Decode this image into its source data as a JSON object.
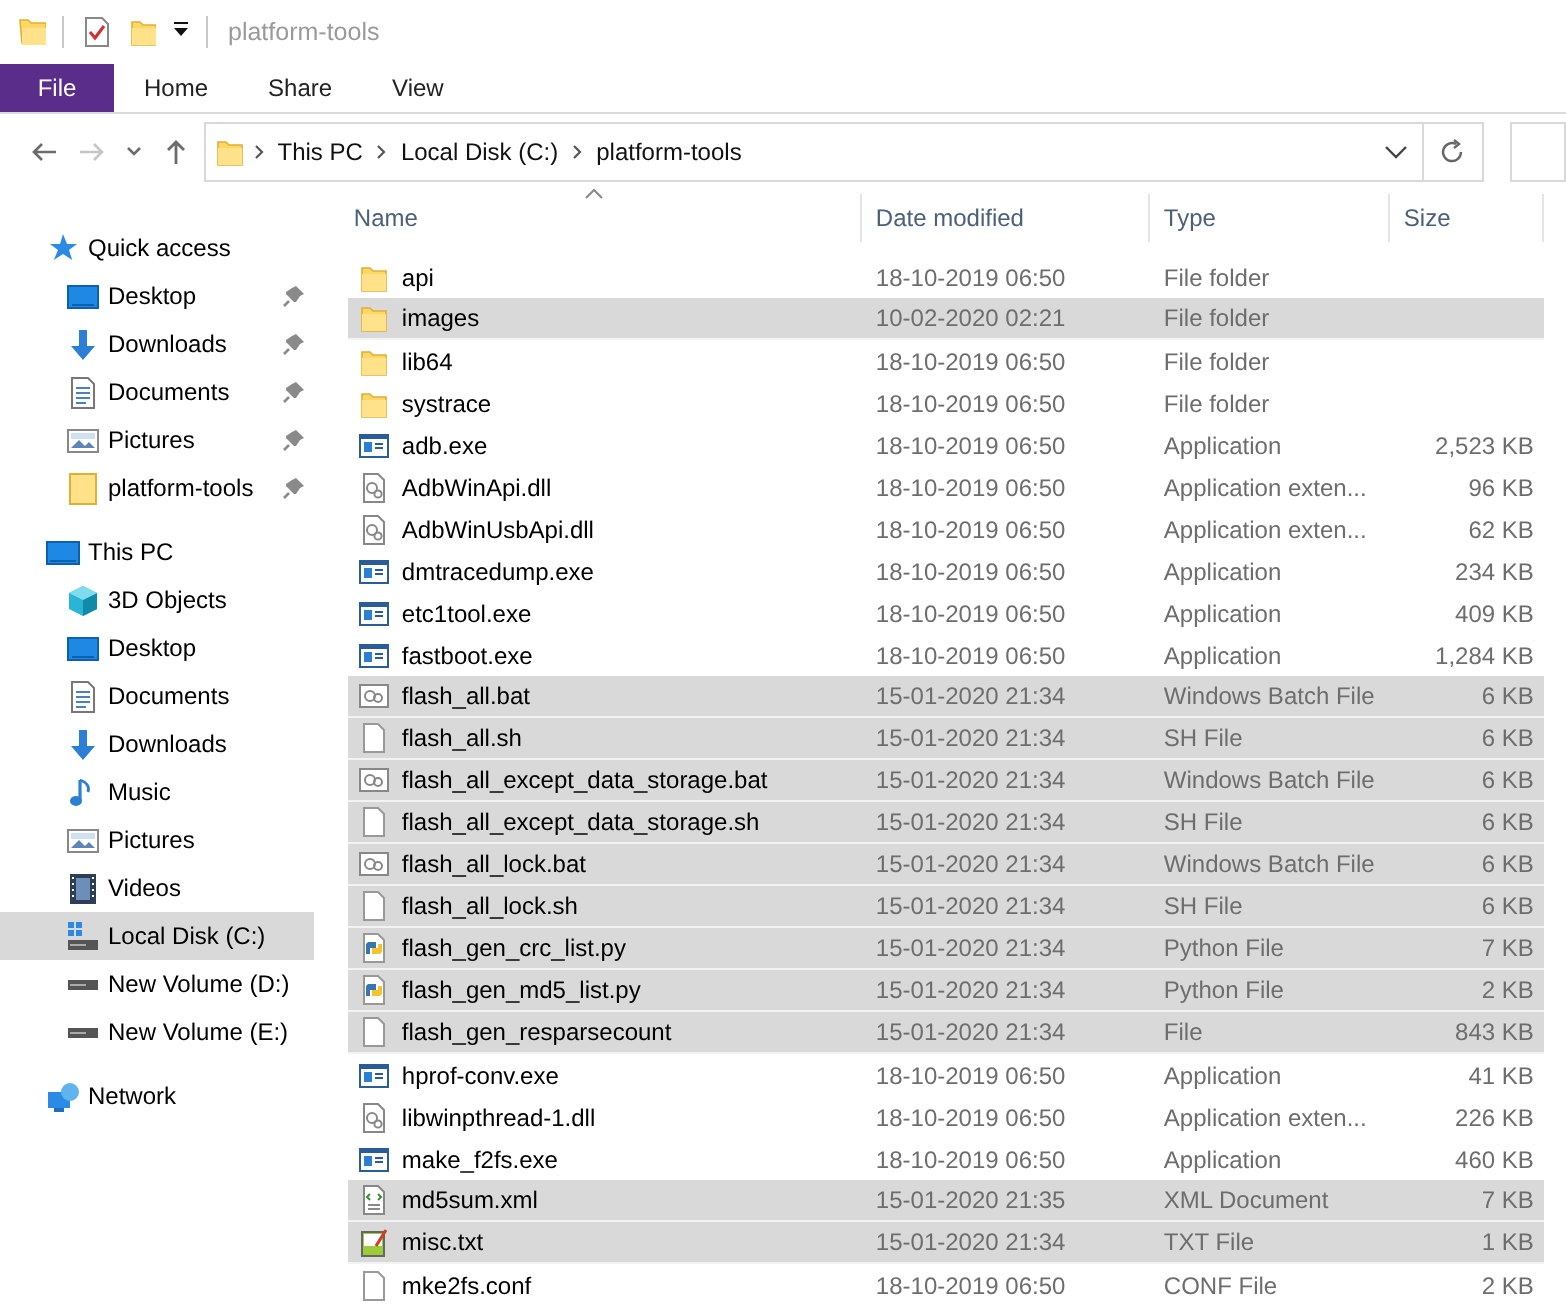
{
  "window": {
    "title": "platform-tools"
  },
  "ribbon_tabs": [
    {
      "label": "File",
      "kind": "menu"
    },
    {
      "label": "Home",
      "kind": "tab"
    },
    {
      "label": "Share",
      "kind": "tab"
    },
    {
      "label": "View",
      "kind": "tab"
    }
  ],
  "nav_buttons": [
    {
      "kind": "back",
      "disabled": false
    },
    {
      "kind": "forward",
      "disabled": true
    },
    {
      "kind": "recent",
      "disabled": false
    },
    {
      "kind": "up",
      "disabled": false
    }
  ],
  "address_bar": {
    "path": [
      "This PC",
      "Local Disk (C:)",
      "platform-tools"
    ]
  },
  "sidebar": {
    "items": [
      {
        "label": "Quick access",
        "kind": "star",
        "selected": false,
        "children": [
          {
            "label": "Desktop",
            "kind": "desktop",
            "pinned": true,
            "selected": false
          },
          {
            "label": "Downloads",
            "kind": "download",
            "pinned": true,
            "selected": false
          },
          {
            "label": "Documents",
            "kind": "document",
            "pinned": true,
            "selected": false
          },
          {
            "label": "Pictures",
            "kind": "pictures",
            "pinned": true,
            "selected": false
          },
          {
            "label": "platform-tools",
            "kind": "folder",
            "pinned": true,
            "selected": false
          }
        ]
      },
      {
        "label": "This PC",
        "kind": "pc",
        "selected": false,
        "children": [
          {
            "label": "3D Objects",
            "kind": "cube",
            "pinned": false,
            "selected": false
          },
          {
            "label": "Desktop",
            "kind": "desktop",
            "pinned": false,
            "selected": false
          },
          {
            "label": "Documents",
            "kind": "document",
            "pinned": false,
            "selected": false
          },
          {
            "label": "Downloads",
            "kind": "download",
            "pinned": false,
            "selected": false
          },
          {
            "label": "Music",
            "kind": "music",
            "pinned": false,
            "selected": false
          },
          {
            "label": "Pictures",
            "kind": "pictures",
            "pinned": false,
            "selected": false
          },
          {
            "label": "Videos",
            "kind": "videos",
            "pinned": false,
            "selected": false
          },
          {
            "label": "Local Disk (C:)",
            "kind": "system-drive",
            "pinned": false,
            "selected": true
          },
          {
            "label": "New Volume (D:)",
            "kind": "drive",
            "pinned": false,
            "selected": false
          },
          {
            "label": "New Volume (E:)",
            "kind": "drive",
            "pinned": false,
            "selected": false
          }
        ]
      },
      {
        "label": "Network",
        "kind": "network",
        "selected": false
      }
    ]
  },
  "file_list": {
    "columns": [
      {
        "label": "Name",
        "sorted": true
      },
      {
        "label": "Date modified",
        "sorted": false
      },
      {
        "label": "Type",
        "sorted": false
      },
      {
        "label": "Size",
        "sorted": false
      }
    ],
    "rows": [
      {
        "name": "api",
        "date": "18-10-2019 06:50",
        "type": "File folder",
        "size": "",
        "kind": "folder",
        "selected": false
      },
      {
        "name": "images",
        "date": "10-02-2020 02:21",
        "type": "File folder",
        "size": "",
        "kind": "folder",
        "selected": true
      },
      {
        "name": "lib64",
        "date": "18-10-2019 06:50",
        "type": "File folder",
        "size": "",
        "kind": "folder",
        "selected": false
      },
      {
        "name": "systrace",
        "date": "18-10-2019 06:50",
        "type": "File folder",
        "size": "",
        "kind": "folder",
        "selected": false
      },
      {
        "name": "adb.exe",
        "date": "18-10-2019 06:50",
        "type": "Application",
        "size": "2,523 KB",
        "kind": "exe",
        "selected": false
      },
      {
        "name": "AdbWinApi.dll",
        "date": "18-10-2019 06:50",
        "type": "Application exten...",
        "size": "96 KB",
        "kind": "dll",
        "selected": false
      },
      {
        "name": "AdbWinUsbApi.dll",
        "date": "18-10-2019 06:50",
        "type": "Application exten...",
        "size": "62 KB",
        "kind": "dll",
        "selected": false
      },
      {
        "name": "dmtracedump.exe",
        "date": "18-10-2019 06:50",
        "type": "Application",
        "size": "234 KB",
        "kind": "exe",
        "selected": false
      },
      {
        "name": "etc1tool.exe",
        "date": "18-10-2019 06:50",
        "type": "Application",
        "size": "409 KB",
        "kind": "exe",
        "selected": false
      },
      {
        "name": "fastboot.exe",
        "date": "18-10-2019 06:50",
        "type": "Application",
        "size": "1,284 KB",
        "kind": "exe",
        "selected": false
      },
      {
        "name": "flash_all.bat",
        "date": "15-01-2020 21:34",
        "type": "Windows Batch File",
        "size": "6 KB",
        "kind": "bat",
        "selected": true
      },
      {
        "name": "flash_all.sh",
        "date": "15-01-2020 21:34",
        "type": "SH File",
        "size": "6 KB",
        "kind": "file",
        "selected": true
      },
      {
        "name": "flash_all_except_data_storage.bat",
        "date": "15-01-2020 21:34",
        "type": "Windows Batch File",
        "size": "6 KB",
        "kind": "bat",
        "selected": true
      },
      {
        "name": "flash_all_except_data_storage.sh",
        "date": "15-01-2020 21:34",
        "type": "SH File",
        "size": "6 KB",
        "kind": "file",
        "selected": true
      },
      {
        "name": "flash_all_lock.bat",
        "date": "15-01-2020 21:34",
        "type": "Windows Batch File",
        "size": "6 KB",
        "kind": "bat",
        "selected": true
      },
      {
        "name": "flash_all_lock.sh",
        "date": "15-01-2020 21:34",
        "type": "SH File",
        "size": "6 KB",
        "kind": "file",
        "selected": true
      },
      {
        "name": "flash_gen_crc_list.py",
        "date": "15-01-2020 21:34",
        "type": "Python File",
        "size": "7 KB",
        "kind": "py",
        "selected": true
      },
      {
        "name": "flash_gen_md5_list.py",
        "date": "15-01-2020 21:34",
        "type": "Python File",
        "size": "2 KB",
        "kind": "py",
        "selected": true
      },
      {
        "name": "flash_gen_resparsecount",
        "date": "15-01-2020 21:34",
        "type": "File",
        "size": "843 KB",
        "kind": "file",
        "selected": true
      },
      {
        "name": "hprof-conv.exe",
        "date": "18-10-2019 06:50",
        "type": "Application",
        "size": "41 KB",
        "kind": "exe",
        "selected": false
      },
      {
        "name": "libwinpthread-1.dll",
        "date": "18-10-2019 06:50",
        "type": "Application exten...",
        "size": "226 KB",
        "kind": "dll",
        "selected": false
      },
      {
        "name": "make_f2fs.exe",
        "date": "18-10-2019 06:50",
        "type": "Application",
        "size": "460 KB",
        "kind": "exe",
        "selected": false
      },
      {
        "name": "md5sum.xml",
        "date": "15-01-2020 21:35",
        "type": "XML Document",
        "size": "7 KB",
        "kind": "xml",
        "selected": true
      },
      {
        "name": "misc.txt",
        "date": "15-01-2020 21:34",
        "type": "TXT File",
        "size": "1 KB",
        "kind": "txt",
        "selected": true
      },
      {
        "name": "mke2fs.conf",
        "date": "18-10-2019 06:50",
        "type": "CONF File",
        "size": "2 KB",
        "kind": "file",
        "selected": false
      }
    ]
  }
}
